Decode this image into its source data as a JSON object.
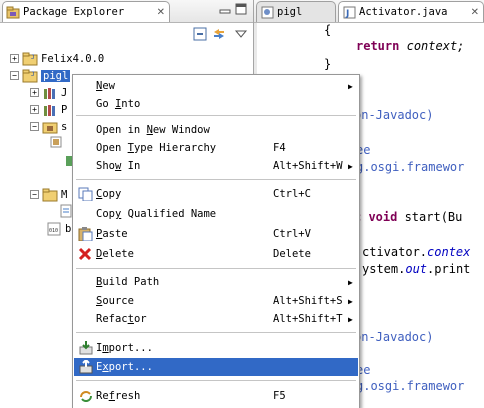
{
  "package_explorer": {
    "tab_title": "Package Explorer",
    "tree": [
      {
        "label": "Felix4.0.0",
        "expander": "+"
      },
      {
        "label": "pigl",
        "expander": "-",
        "selected": true
      },
      {
        "label": "J",
        "expander": "+"
      },
      {
        "label": "P",
        "expander": "+"
      },
      {
        "label": "s",
        "expander": "-"
      },
      {
        "label": "M",
        "expander": "-"
      },
      {
        "label": "b"
      }
    ]
  },
  "editor": {
    "tabs": [
      {
        "label": "pigl",
        "active": false
      },
      {
        "label": "Activator.java",
        "active": true
      }
    ],
    "code_lines": [
      {
        "text": "{"
      },
      {
        "kw": "return",
        "rest": "context;"
      },
      {
        "text": "}"
      },
      {
        "comment": "on-Javadoc)"
      },
      {
        "comment": "ee"
      },
      {
        "comment": "g.osgi.framewor"
      },
      {
        "kw": "c void",
        "rest": " start(Bu"
      },
      {
        "pre": "ctivator.",
        "field": "contex"
      },
      {
        "pre": "ystem.",
        "field": "out",
        "post": ".print"
      },
      {
        "comment": "on-Javadoc)"
      },
      {
        "comment": "ee"
      },
      {
        "comment": "g.osgi.framewor"
      }
    ]
  },
  "context_menu": {
    "items": [
      {
        "id": "new",
        "label": "New",
        "mnemonic": "N",
        "shortcut": "",
        "submenu": true
      },
      {
        "id": "go-into",
        "label": "Go Into",
        "mnemonic": "I",
        "shortcut": "",
        "submenu": false
      },
      {
        "id": "open-new-window",
        "label": "Open in New Window",
        "mnemonic": "N",
        "shortcut": "",
        "submenu": false
      },
      {
        "id": "open-type-hierarchy",
        "label": "Open Type Hierarchy",
        "mnemonic": "T",
        "shortcut": "F4",
        "submenu": false
      },
      {
        "id": "show-in",
        "label": "Show In",
        "mnemonic": "w",
        "shortcut": "Alt+Shift+W",
        "submenu": true
      },
      {
        "id": "copy",
        "label": "Copy",
        "mnemonic": "C",
        "shortcut": "Ctrl+C",
        "submenu": false
      },
      {
        "id": "copy-qualified-name",
        "label": "Copy Qualified Name",
        "mnemonic": "y",
        "shortcut": "",
        "submenu": false
      },
      {
        "id": "paste",
        "label": "Paste",
        "mnemonic": "P",
        "shortcut": "Ctrl+V",
        "submenu": false
      },
      {
        "id": "delete",
        "label": "Delete",
        "mnemonic": "D",
        "shortcut": "Delete",
        "submenu": false
      },
      {
        "id": "build-path",
        "label": "Build Path",
        "mnemonic": "B",
        "shortcut": "",
        "submenu": true
      },
      {
        "id": "source",
        "label": "Source",
        "mnemonic": "S",
        "shortcut": "Alt+Shift+S",
        "submenu": true
      },
      {
        "id": "refactor",
        "label": "Refactor",
        "mnemonic": "t",
        "shortcut": "Alt+Shift+T",
        "submenu": true
      },
      {
        "id": "import",
        "label": "Import...",
        "mnemonic": "m",
        "shortcut": "",
        "submenu": false
      },
      {
        "id": "export",
        "label": "Export...",
        "mnemonic": "x",
        "shortcut": "",
        "submenu": false,
        "highlighted": true
      },
      {
        "id": "refresh",
        "label": "Refresh",
        "mnemonic": "f",
        "shortcut": "F5",
        "submenu": false
      }
    ],
    "submenu_arrow": "▶"
  },
  "icons": {
    "package-explorer-tab": "package-explorer-icon",
    "collapse-all": "collapse-all-icon",
    "link-with-editor": "link-with-editor-icon",
    "view-menu": "view-menu-icon",
    "project": "java-project-folder-icon",
    "jre-library": "library-icon",
    "source-folder": "source-folder-icon",
    "binary-file": "binary-file-icon",
    "copy": "copy-icon",
    "paste": "paste-icon",
    "delete": "delete-icon",
    "import": "import-icon",
    "export": "export-icon",
    "refresh": "refresh-icon"
  },
  "colors": {
    "selection": "#3169c6",
    "keyword": "#7f0055",
    "comment": "#3f5fbf",
    "field": "#0000c0",
    "delete_icon": "#d42020"
  }
}
